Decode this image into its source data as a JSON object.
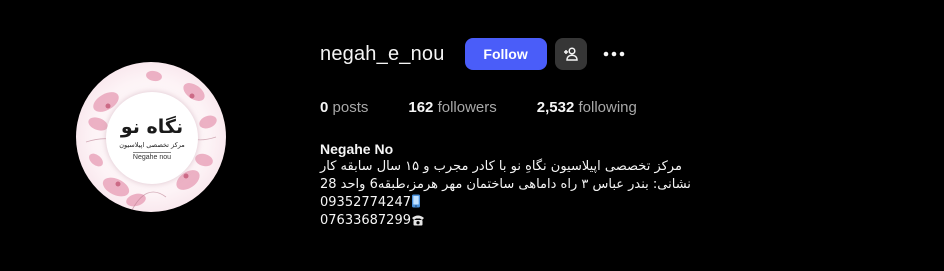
{
  "profile": {
    "username": "negah_e_nou",
    "follow_label": "Follow",
    "suggest_icon": "person-add-icon",
    "more_icon": "more-horizontal-icon",
    "avatar": {
      "title": "نگاه نو",
      "subtitle": "مرکز تخصصی اپیلاسیون",
      "latin_name": "Negahe nou",
      "accent": "#e8a7bd"
    }
  },
  "stats": {
    "posts_count": "0",
    "posts_label": "posts",
    "followers_count": "162",
    "followers_label": "followers",
    "following_count": "2,532",
    "following_label": "following"
  },
  "bio": {
    "name": "Negahe No",
    "line1": "مرکز تخصصی اپیلاسیون نگاهِ نو با کادر مجرب و ۱۵ سال سابقه کار",
    "line2": "نشانی: بندر عباس ۳ راه داماهی ساختمان مهر هرمز،طبقه6 واحد 28",
    "mobile": "09352774247",
    "mobile_icon": "mobile-phone-icon",
    "phone": "07633687299",
    "phone_icon": "telephone-icon"
  },
  "colors": {
    "background": "#000000",
    "primary_button": "#4a5df9",
    "secondary_button": "#363636",
    "muted_text": "#a8a8a8"
  }
}
